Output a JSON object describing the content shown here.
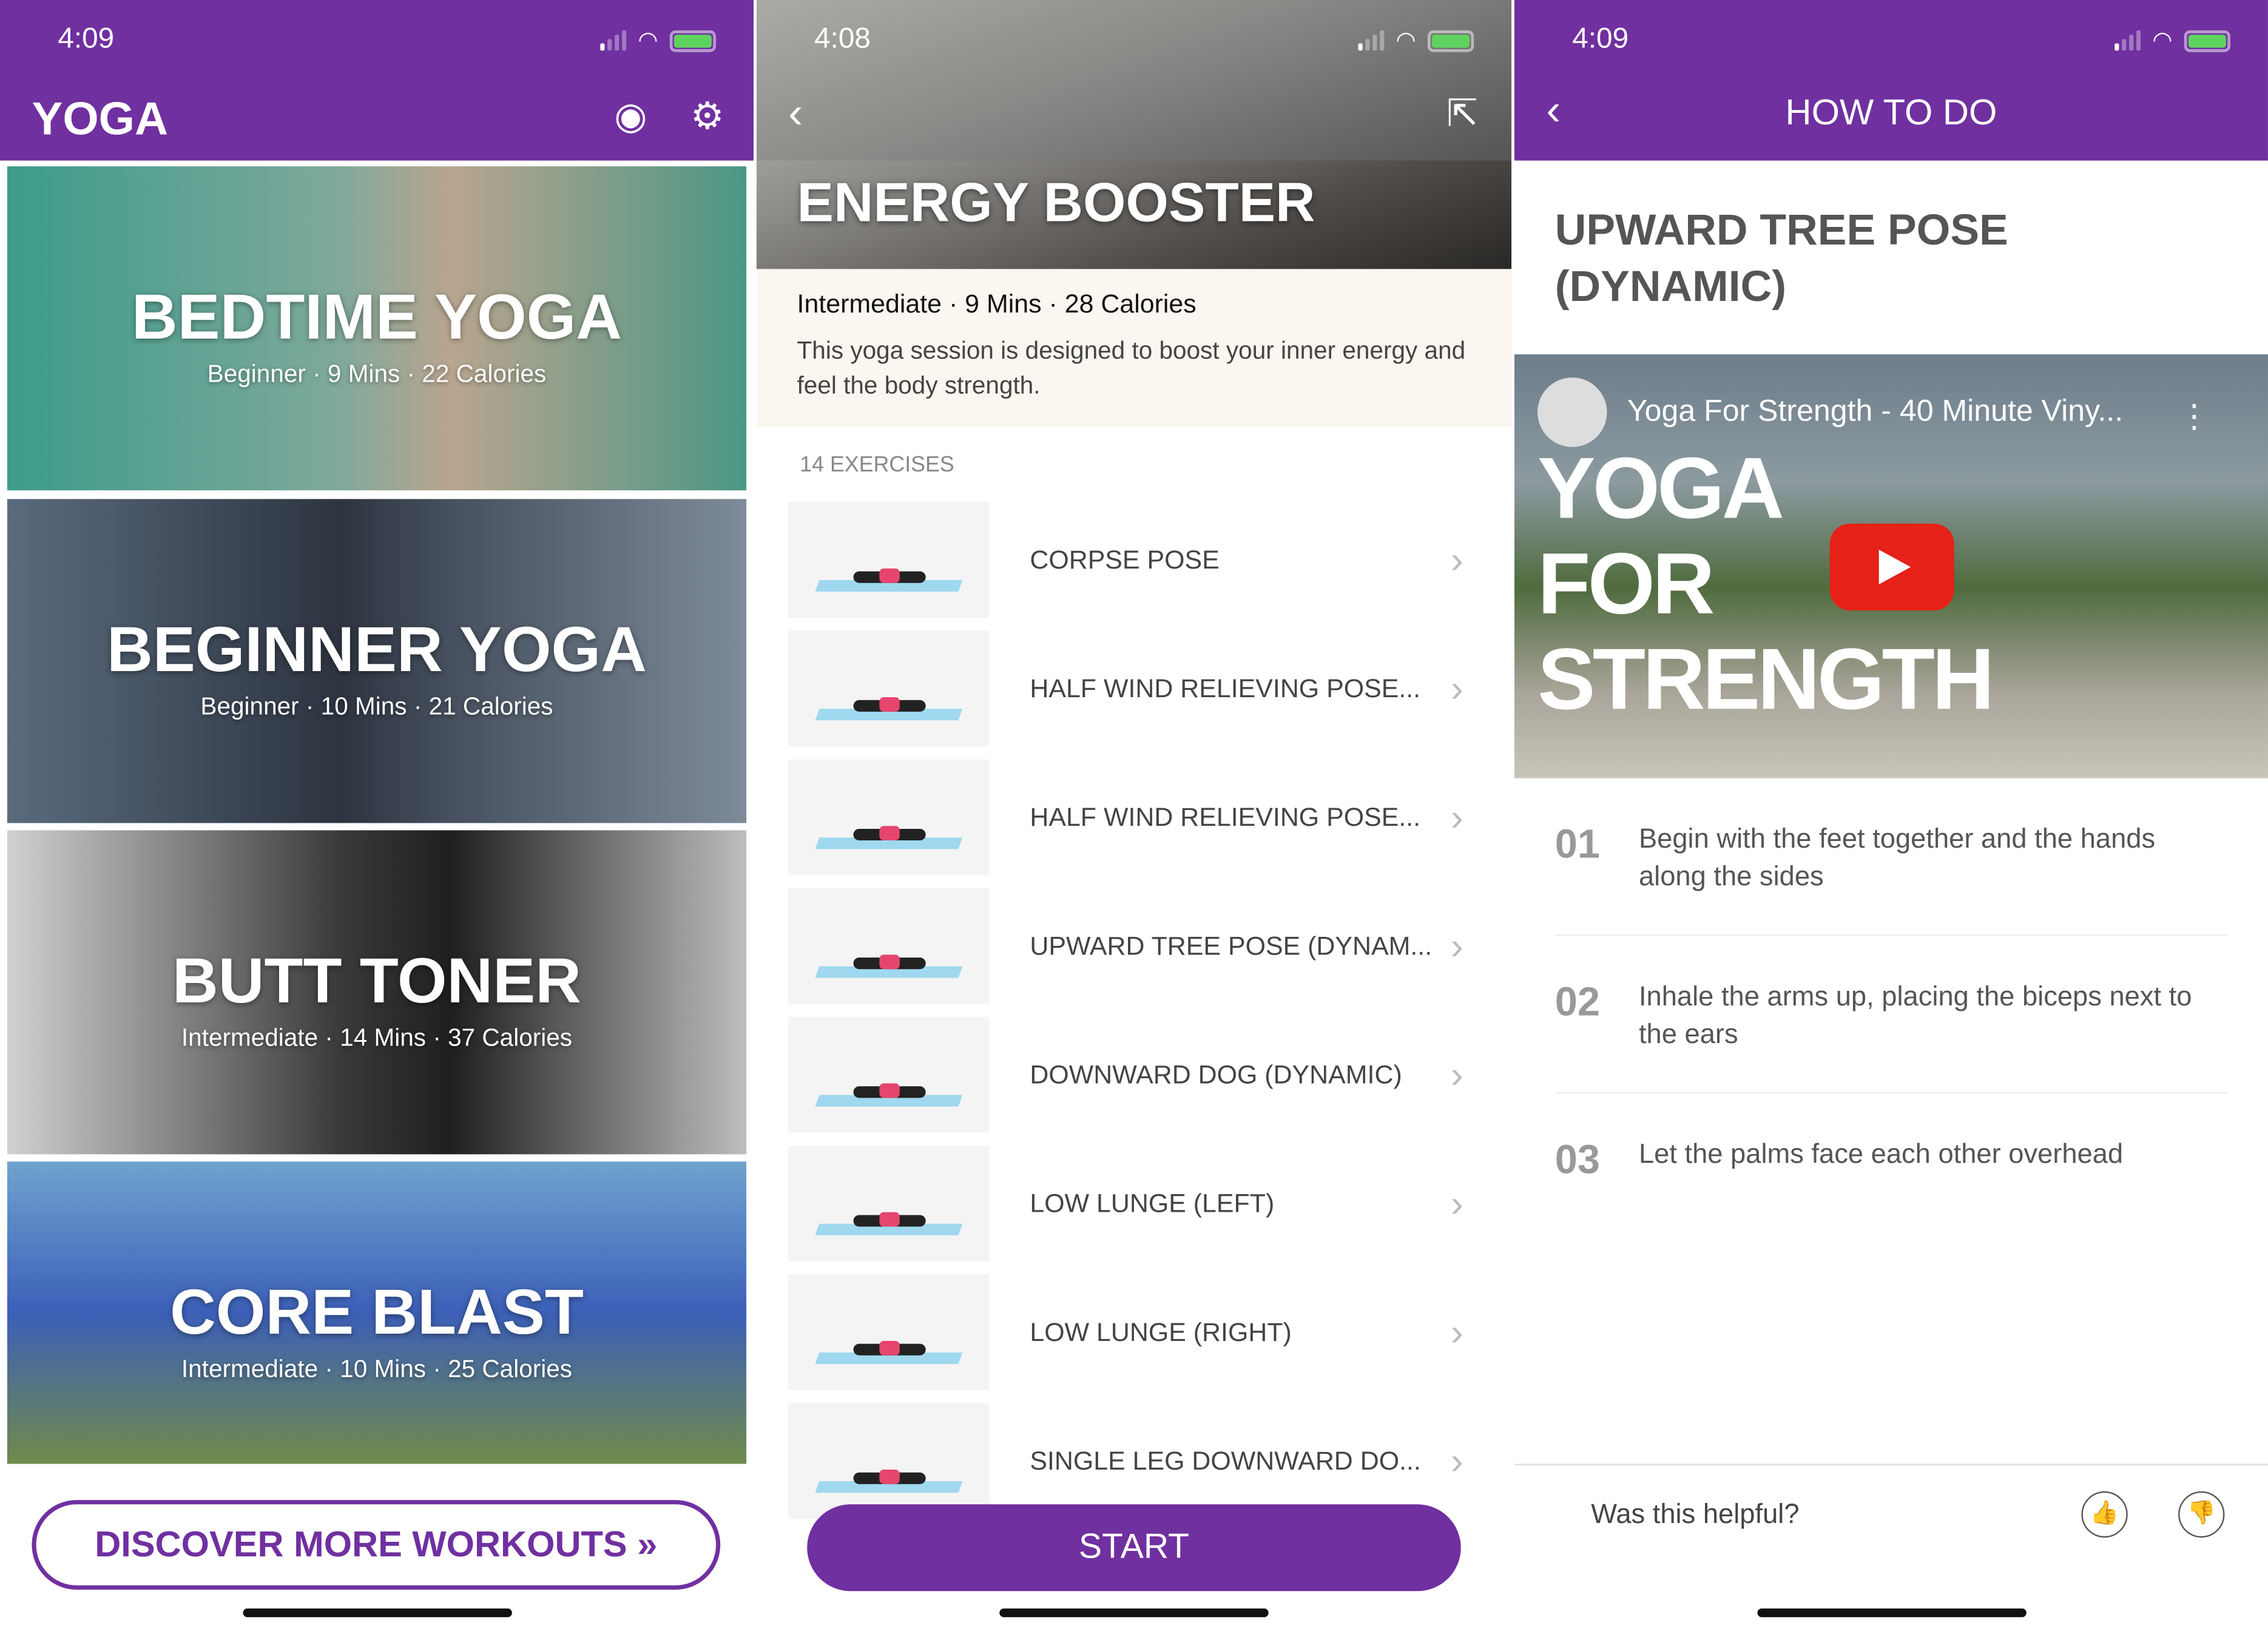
{
  "colors": {
    "accent": "#7030a0",
    "battery": "#5fd35f",
    "play": "#e62117"
  },
  "screen1": {
    "status_time": "4:09",
    "title": "YOGA",
    "icons": [
      "profile-icon",
      "gear-icon"
    ],
    "workouts": [
      {
        "title": "BEDTIME YOGA",
        "meta": "Beginner · 9 Mins · 22 Calories"
      },
      {
        "title": "BEGINNER YOGA",
        "meta": "Beginner · 10 Mins · 21 Calories"
      },
      {
        "title": "BUTT TONER",
        "meta": "Intermediate · 14 Mins · 37 Calories"
      },
      {
        "title": "CORE BLAST",
        "meta": "Intermediate · 10 Mins · 25 Calories"
      }
    ],
    "discover_label": "DISCOVER MORE WORKOUTS »"
  },
  "screen2": {
    "status_time": "4:08",
    "title": "ENERGY BOOSTER",
    "meta": "Intermediate · 9 Mins · 28 Calories",
    "description": "This yoga session is designed to boost your inner energy and feel the body strength.",
    "exercise_count": "14 EXERCISES",
    "exercises": [
      "CORPSE POSE",
      "HALF WIND RELIEVING POSE...",
      "HALF WIND RELIEVING POSE...",
      "UPWARD TREE POSE (DYNAM...",
      "DOWNWARD DOG (DYNAMIC)",
      "LOW LUNGE (LEFT)",
      "LOW LUNGE (RIGHT)",
      "SINGLE LEG DOWNWARD DO..."
    ],
    "start_label": "START"
  },
  "screen3": {
    "status_time": "4:09",
    "title": "HOW TO DO",
    "pose_line1": "UPWARD TREE POSE",
    "pose_line2": "(DYNAMIC)",
    "video_title": "Yoga For Strength - 40 Minute Viny...",
    "video_overlay": "YOGA FOR STRENGTH",
    "steps": [
      {
        "num": "01",
        "text": "Begin with the feet together and the hands along the sides"
      },
      {
        "num": "02",
        "text": "Inhale the arms up, placing the biceps next to the ears"
      },
      {
        "num": "03",
        "text": "Let the palms face each other overhead"
      }
    ],
    "helpful_label": "Was this helpful?"
  }
}
